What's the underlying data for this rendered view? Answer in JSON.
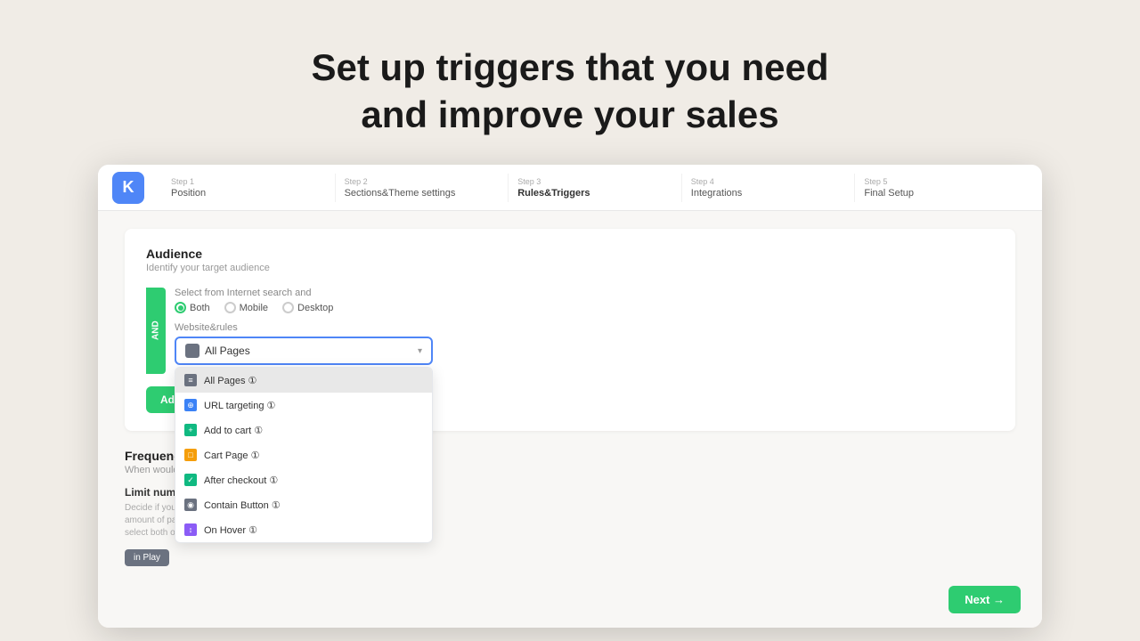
{
  "hero": {
    "line1": "Set up triggers that you need",
    "line2": "and improve your sales"
  },
  "steps": [
    {
      "label": "Step 1",
      "name": "Position",
      "active": false
    },
    {
      "label": "Step 2",
      "name": "Sections&Theme settings",
      "active": false
    },
    {
      "label": "Step 3",
      "name": "Rules&Triggers",
      "active": true
    },
    {
      "label": "Step 4",
      "name": "Integrations",
      "active": false
    },
    {
      "label": "Step 5",
      "name": "Final Setup",
      "active": false
    }
  ],
  "logo": "K",
  "audience_section": {
    "title": "Audience",
    "subtitle": "Identify your target audience",
    "and_label": "AND",
    "device_label": "Select from Internet search and",
    "radios": [
      {
        "label": "Both",
        "selected": true
      },
      {
        "label": "Mobile",
        "selected": false
      },
      {
        "label": "Desktop",
        "selected": false
      }
    ],
    "trigger_label": "Website&rules",
    "dropdown_value": "All Pages",
    "dropdown_items": [
      {
        "label": "All Pages ①",
        "highlighted": true,
        "icon_type": "gray"
      },
      {
        "label": "URL targeting ①",
        "highlighted": false,
        "icon_type": "blue"
      },
      {
        "label": "Add to cart ①",
        "highlighted": false,
        "icon_type": "green"
      },
      {
        "label": "Cart Page ①",
        "highlighted": false,
        "icon_type": "orange"
      },
      {
        "label": "After checkout ①",
        "highlighted": false,
        "icon_type": "green"
      },
      {
        "label": "Contain Button ①",
        "highlighted": false,
        "icon_type": "gray"
      },
      {
        "label": "On Hover ①",
        "highlighted": false,
        "icon_type": "purple"
      }
    ],
    "add_button": "Add audience targeting"
  },
  "frequency_section": {
    "title": "Frequency Settings",
    "subtitle": "When would you prefer the popup to be displayed?",
    "limit_label": "Limit number of time",
    "limit_desc": "Decide if you want to show Popup after certain amount of pages of time. Please note that if you select both options, the"
  },
  "next_button": "Next →"
}
